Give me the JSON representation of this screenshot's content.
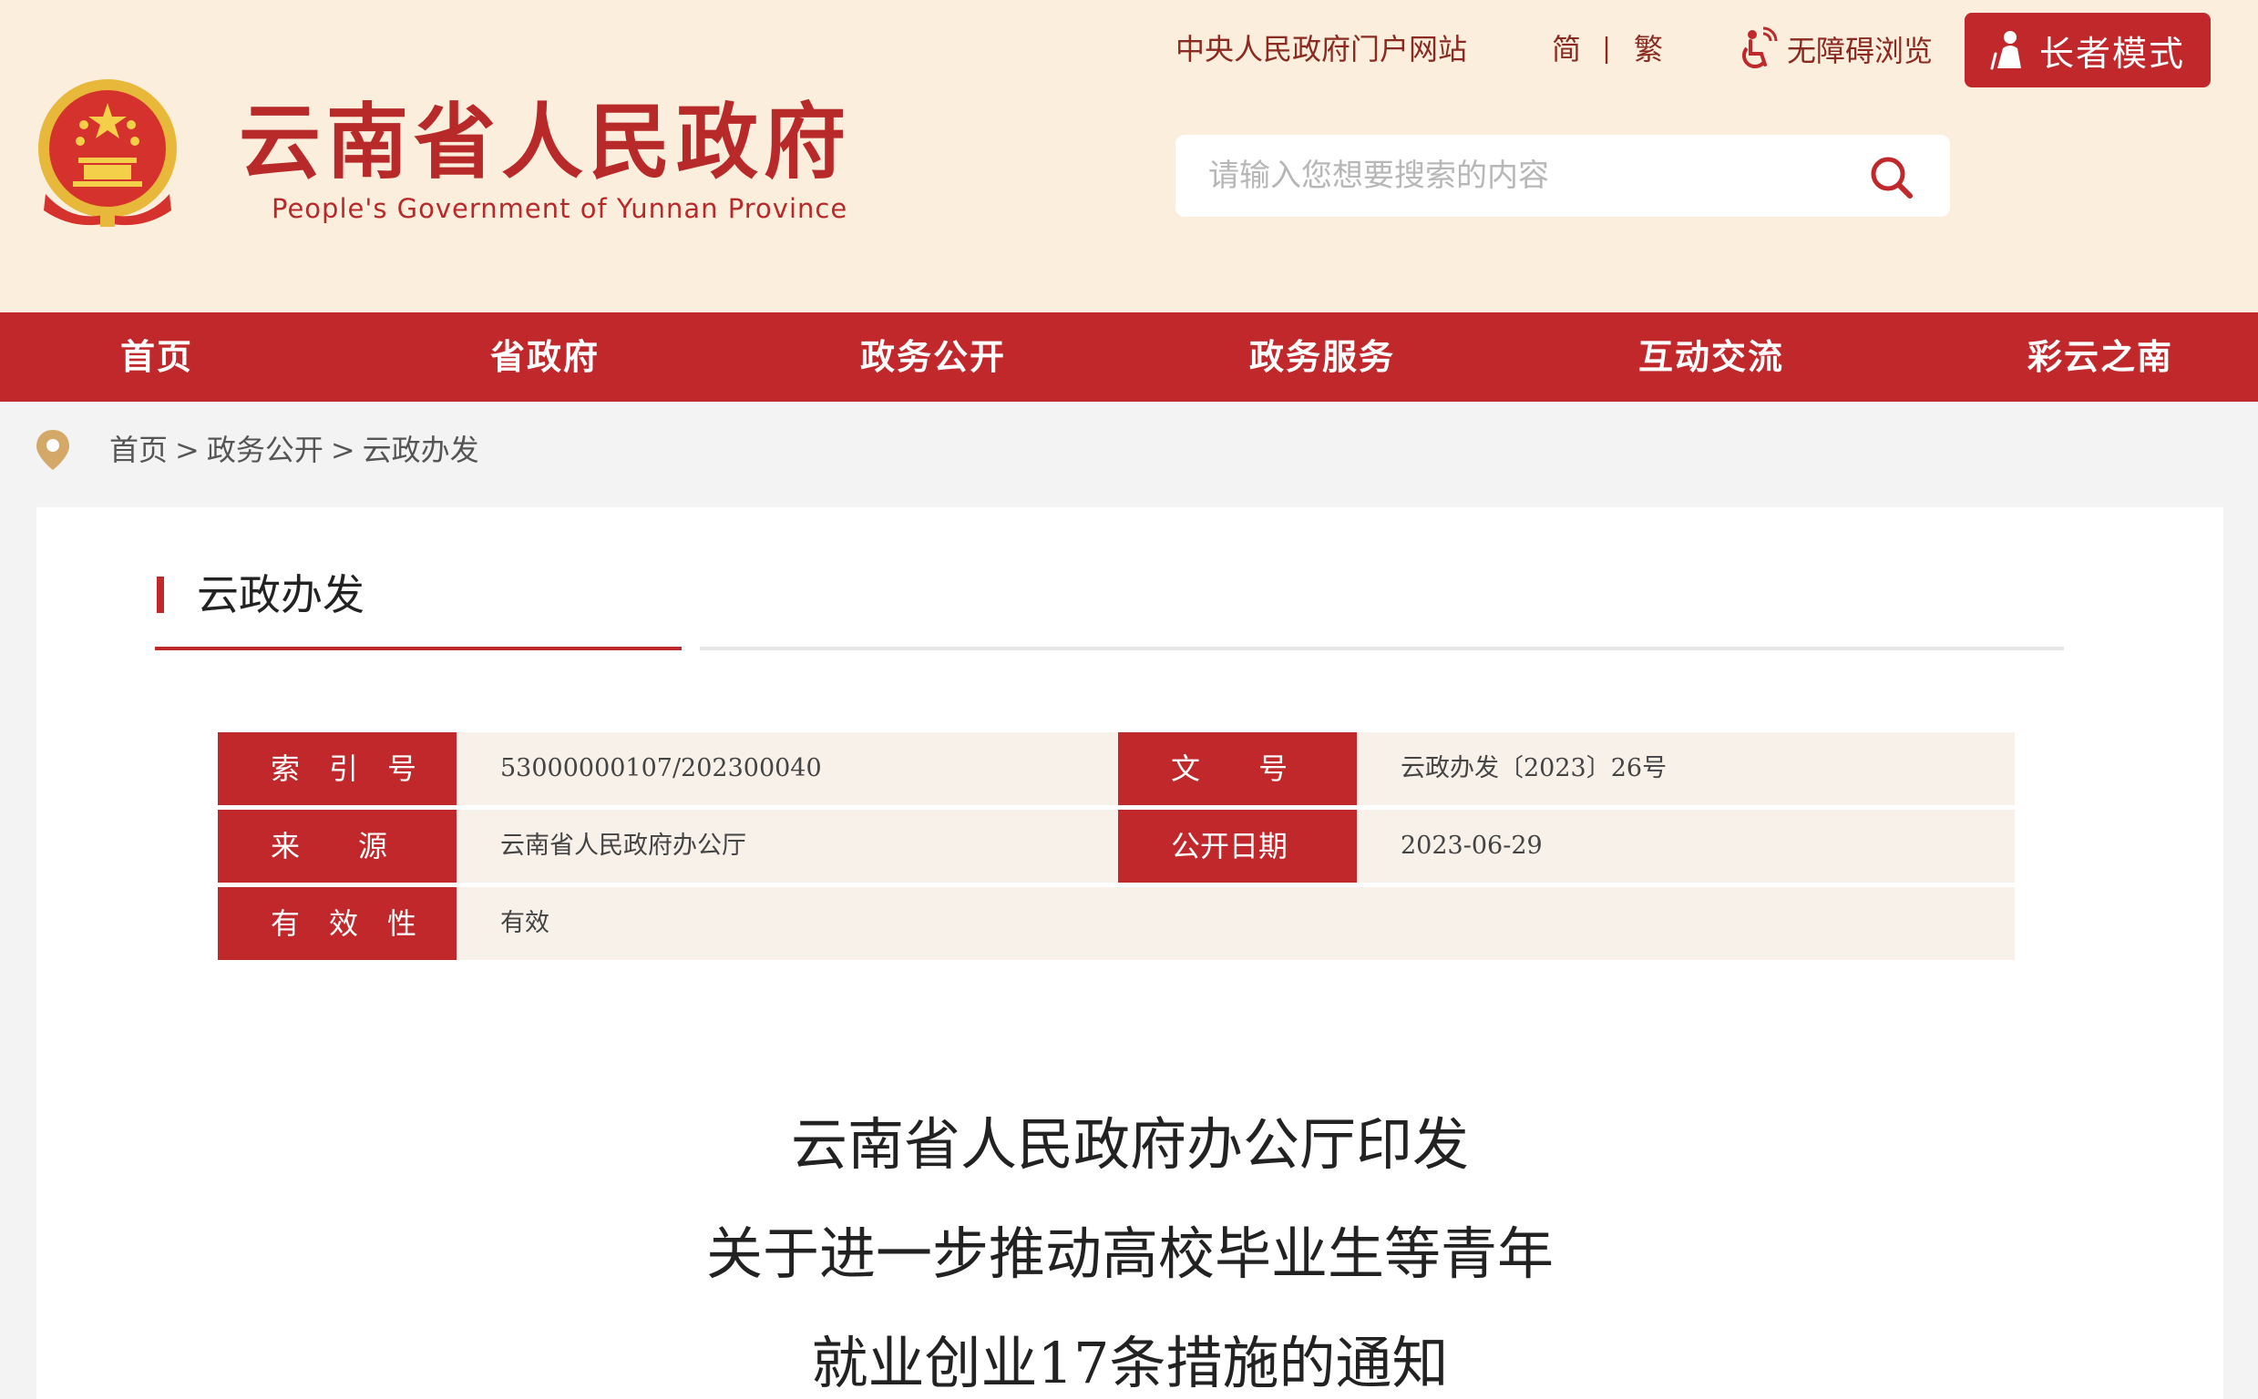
{
  "header": {
    "site_title": "云南省人民政府",
    "site_subtitle": "People's Government of Yunnan Province",
    "top_links": {
      "central_portal": "中央人民政府门户网站",
      "simplified": "简",
      "separator": "|",
      "traditional": "繁",
      "accessibility": "无障碍浏览",
      "elder_mode": "长者模式"
    },
    "search": {
      "placeholder": "请输入您想要搜索的内容"
    }
  },
  "nav": {
    "items": [
      "首页",
      "省政府",
      "政务公开",
      "政务服务",
      "互动交流",
      "彩云之南"
    ]
  },
  "breadcrumb": {
    "items": [
      "首页",
      "政务公开",
      "云政办发"
    ],
    "separator": ">"
  },
  "section": {
    "title": "云政办发"
  },
  "meta": {
    "index_no": {
      "label": "索　引　号",
      "value": "53000000107/202300040"
    },
    "doc_no": {
      "label": "文　　号",
      "value": "云政办发〔2023〕26号"
    },
    "source": {
      "label": "来　　源",
      "value": "云南省人民政府办公厅"
    },
    "publish_date": {
      "label": "公开日期",
      "value": "2023-06-29"
    },
    "validity": {
      "label": "有　效　性",
      "value": "有效"
    }
  },
  "document": {
    "title_lines": [
      "云南省人民政府办公厅印发",
      "关于进一步推动高校毕业生等青年",
      "就业创业17条措施的通知"
    ]
  },
  "colors": {
    "brand_red": "#c0282c",
    "header_bg": "#fbeedd",
    "meta_value_bg": "#f8f1ea",
    "emblem_gold": "#e8b83a"
  },
  "icons": [
    "national-emblem-icon",
    "accessibility-icon",
    "elder-person-icon",
    "search-icon",
    "location-pin-icon"
  ]
}
